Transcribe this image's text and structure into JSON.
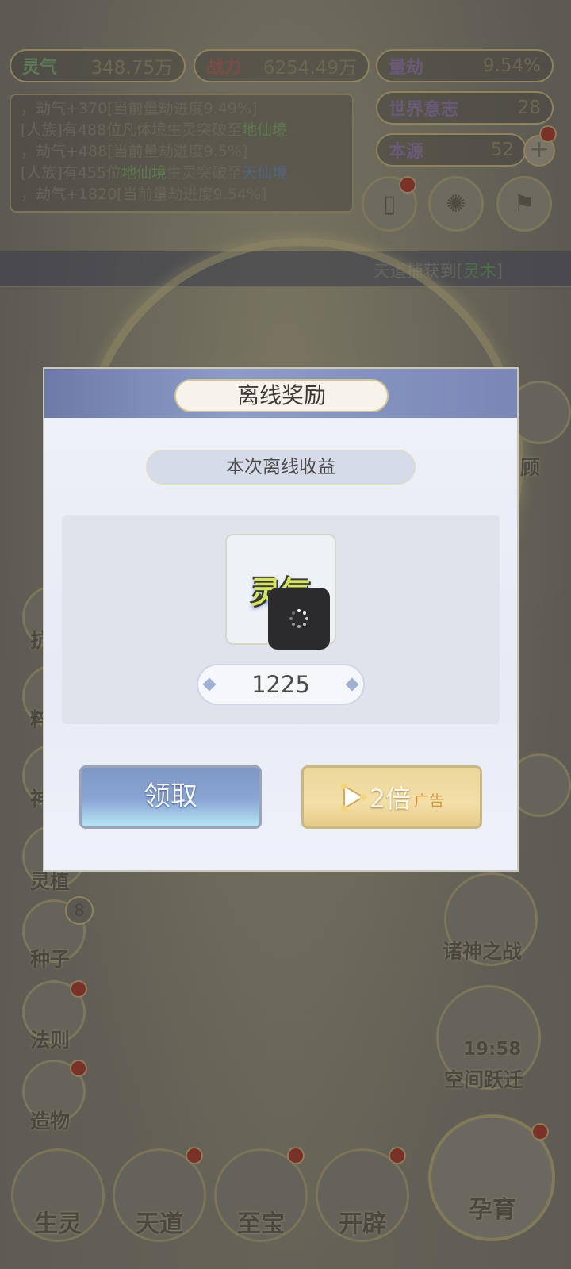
{
  "stats": {
    "lingqi": {
      "label": "灵气",
      "value": "348.75万"
    },
    "zhanli": {
      "label": "战力",
      "value": "6254.49万"
    },
    "liangjie": {
      "label": "量劫",
      "value": "9.54%"
    },
    "world_will": {
      "label": "世界意志",
      "value": "28"
    },
    "source": {
      "label": "本源",
      "value": "52"
    }
  },
  "log": {
    "line1": "，劫气+370[当前量劫进度9.49%]",
    "line2_a": "[人族]有488位凡体境生灵突破至",
    "line2_hl": "地仙境",
    "line3": "，劫气+488[当前量劫进度9.5%]",
    "line4_a": "[人族]有455位",
    "line4_hl1": "地仙境",
    "line4_b": "生灵突破至",
    "line4_hl2": "天仙境",
    "line5": "，劫气+1820[当前量劫进度9.54%]"
  },
  "banner": {
    "prefix": "天道捕获到[",
    "item": "灵木",
    "suffix": "]"
  },
  "right_partial": {
    "label": "顾"
  },
  "left_partial": [
    "抗",
    "粹",
    "神"
  ],
  "left_menu": [
    {
      "label": "灵植"
    },
    {
      "label": "种子",
      "badge": "8"
    },
    {
      "label": "法则"
    },
    {
      "label": "造物"
    }
  ],
  "right_menu": {
    "war": "诸神之战",
    "space_timer": "19:58",
    "space_label": "空间跃迁"
  },
  "bottom_nav": [
    "生灵",
    "天道",
    "至宝",
    "开辟",
    "孕育"
  ],
  "modal": {
    "title": "离线奖励",
    "subtitle": "本次离线收益",
    "item_name": "灵气",
    "amount": "1225",
    "claim_label": "领取",
    "double_label": "2倍",
    "ad_label": "广告"
  }
}
